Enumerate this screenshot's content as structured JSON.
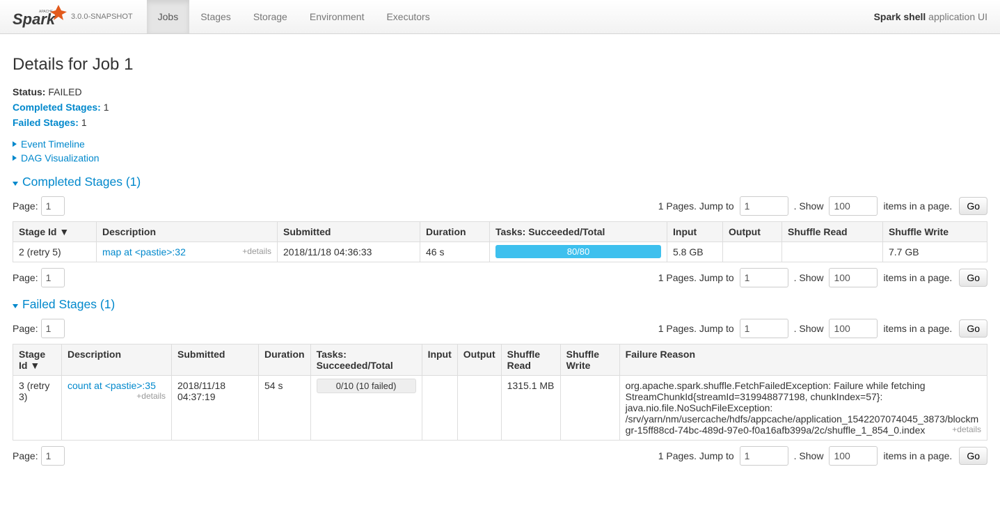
{
  "brand": {
    "version": "3.0.0-SNAPSHOT"
  },
  "nav": {
    "tabs": [
      {
        "label": "Jobs",
        "active": true
      },
      {
        "label": "Stages",
        "active": false
      },
      {
        "label": "Storage",
        "active": false
      },
      {
        "label": "Environment",
        "active": false
      },
      {
        "label": "Executors",
        "active": false
      }
    ]
  },
  "app": {
    "name_bold": "Spark shell",
    "name_rest": " application UI"
  },
  "title": "Details for Job 1",
  "summary": {
    "status_label": "Status:",
    "status_value": "FAILED",
    "completed_label": "Completed Stages:",
    "completed_value": "1",
    "failed_label": "Failed Stages:",
    "failed_value": "1"
  },
  "toggles": {
    "event_timeline": "Event Timeline",
    "dag_viz": "DAG Visualization"
  },
  "sections": {
    "completed": {
      "title": "Completed Stages (1)",
      "headers": [
        "Stage Id ▼",
        "Description",
        "Submitted",
        "Duration",
        "Tasks: Succeeded/Total",
        "Input",
        "Output",
        "Shuffle Read",
        "Shuffle Write"
      ],
      "row": {
        "stage_id": "2 (retry 5)",
        "desc": "map at <pastie>:32",
        "details": "+details",
        "submitted": "2018/11/18 04:36:33",
        "duration": "46 s",
        "tasks": "80/80",
        "input": "5.8 GB",
        "output": "",
        "shuffle_read": "",
        "shuffle_write": "7.7 GB"
      }
    },
    "failed": {
      "title": "Failed Stages (1)",
      "headers": [
        "Stage Id ▼",
        "Description",
        "Submitted",
        "Duration",
        "Tasks: Succeeded/Total",
        "Input",
        "Output",
        "Shuffle Read",
        "Shuffle Write",
        "Failure Reason"
      ],
      "row": {
        "stage_id": "3 (retry 3)",
        "desc": "count at <pastie>:35",
        "details": "+details",
        "submitted": "2018/11/18 04:37:19",
        "duration": "54 s",
        "tasks": "0/10 (10 failed)",
        "input": "",
        "output": "",
        "shuffle_read": "1315.1 MB",
        "shuffle_write": "",
        "failure_reason": "org.apache.spark.shuffle.FetchFailedException: Failure while fetching StreamChunkId{streamId=319948877198, chunkIndex=57}: java.nio.file.NoSuchFileException: /srv/yarn/nm/usercache/hdfs/appcache/application_1542207074045_3873/blockmgr-15ff88cd-74bc-489d-97e0-f0a16afb399a/2c/shuffle_1_854_0.index",
        "failure_details": "+details"
      }
    }
  },
  "pagination": {
    "page_label": "Page:",
    "page_value": "1",
    "pages_text": "1 Pages. Jump to",
    "jump_value": "1",
    "show_label": ". Show",
    "show_value": "100",
    "items_label": "items in a page.",
    "go": "Go"
  }
}
